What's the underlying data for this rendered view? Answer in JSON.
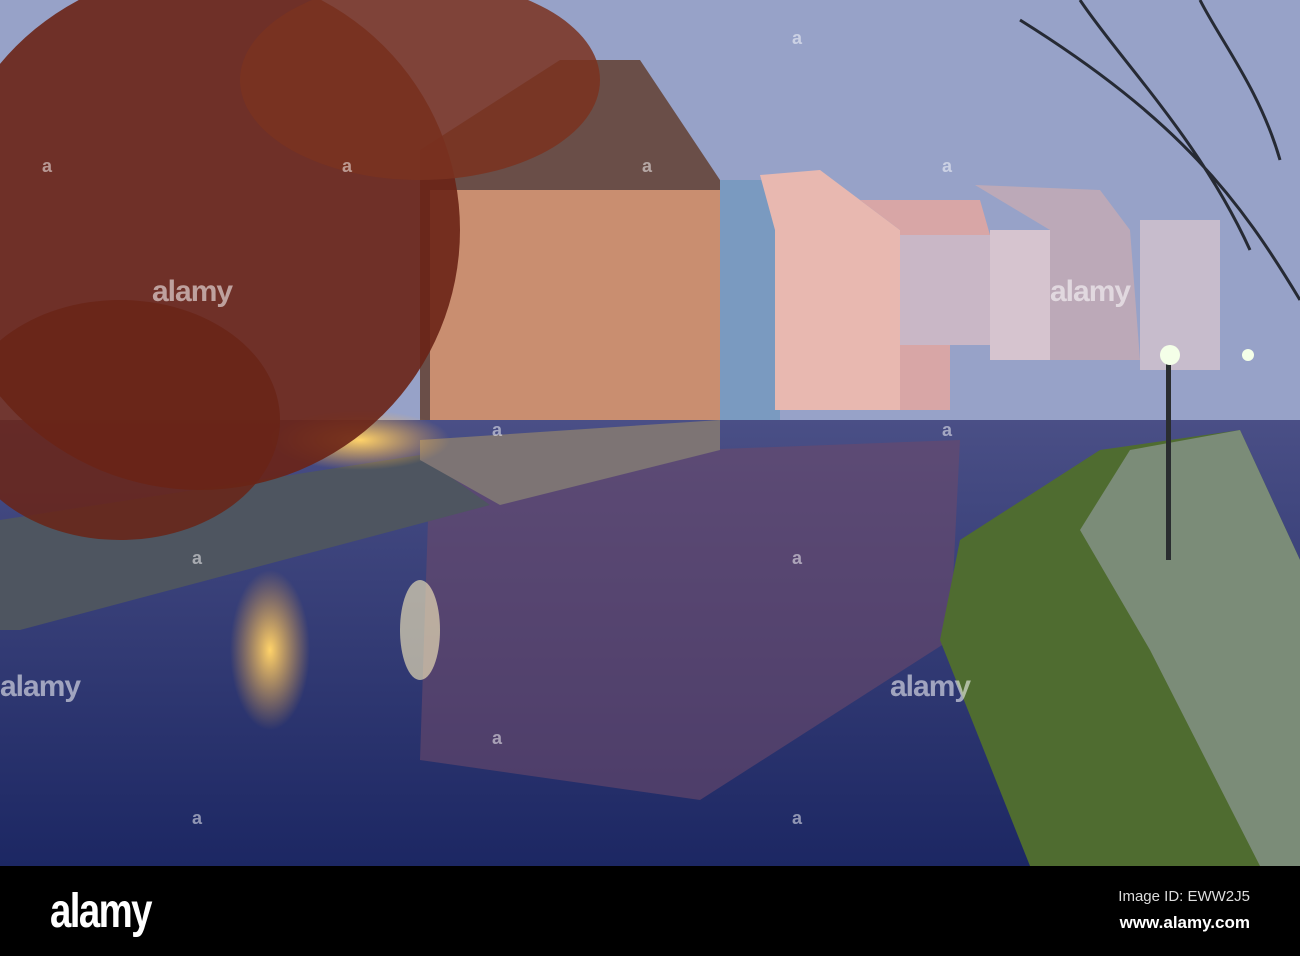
{
  "photo": {
    "subject": "Half-timbered houses along a canal at dusk",
    "watermark_text": "alamy",
    "watermark_marks": [
      "a",
      "a",
      "a",
      "a",
      "a",
      "a",
      "a",
      "a",
      "a",
      "a",
      "a",
      "a"
    ]
  },
  "footer": {
    "logo": "alamy",
    "image_id": "Image ID: EWW2J5",
    "url": "www.alamy.com"
  }
}
